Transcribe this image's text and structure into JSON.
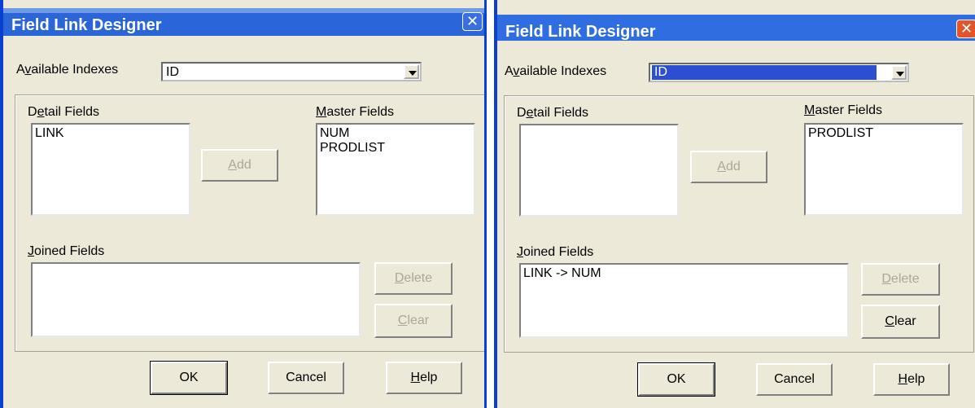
{
  "left": {
    "title": "Field Link Designer",
    "available_indexes_label_pre": "A",
    "available_indexes_label_ul": "v",
    "available_indexes_label_post": "ailable Indexes",
    "index_value": "ID",
    "detail_label_pre": "D",
    "detail_label_ul": "e",
    "detail_label_post": "tail Fields",
    "master_label_ul": "M",
    "master_label_post": "aster Fields",
    "detail_items": [
      "LINK"
    ],
    "master_items": [
      "NUM",
      "PRODLIST"
    ],
    "add_label_ul": "A",
    "add_label_post": "dd",
    "joined_label_ul": "J",
    "joined_label_post": "oined Fields",
    "joined_items": [],
    "delete_label_ul": "D",
    "delete_label_post": "elete",
    "clear_label_ul": "C",
    "clear_label_post": "lear",
    "ok_label": "OK",
    "cancel_label": "Cancel",
    "help_label_ul": "H",
    "help_label_post": "elp"
  },
  "right": {
    "title": "Field Link Designer",
    "available_indexes_label_pre": "A",
    "available_indexes_label_ul": "v",
    "available_indexes_label_post": "ailable Indexes",
    "index_value": "ID",
    "detail_label_pre": "D",
    "detail_label_ul": "e",
    "detail_label_post": "tail Fields",
    "master_label_ul": "M",
    "master_label_post": "aster Fields",
    "detail_items": [],
    "master_items": [
      "PRODLIST"
    ],
    "add_label_ul": "A",
    "add_label_post": "dd",
    "joined_label_ul": "J",
    "joined_label_post": "oined Fields",
    "joined_items": [
      "LINK -> NUM"
    ],
    "delete_label_ul": "D",
    "delete_label_post": "elete",
    "clear_label_ul": "C",
    "clear_label_post": "lear",
    "ok_label": "OK",
    "cancel_label": "Cancel",
    "help_label_ul": "H",
    "help_label_post": "elp"
  },
  "colors": {
    "title_bar": "#2b66d9",
    "dialog_bg": "#ece9d8",
    "selection": "#2c4fd1",
    "close_button_active": "#e0562a",
    "disabled_text": "#aca899"
  },
  "icons": {
    "close": "close-x-icon",
    "dropdown": "chevron-down-icon"
  }
}
